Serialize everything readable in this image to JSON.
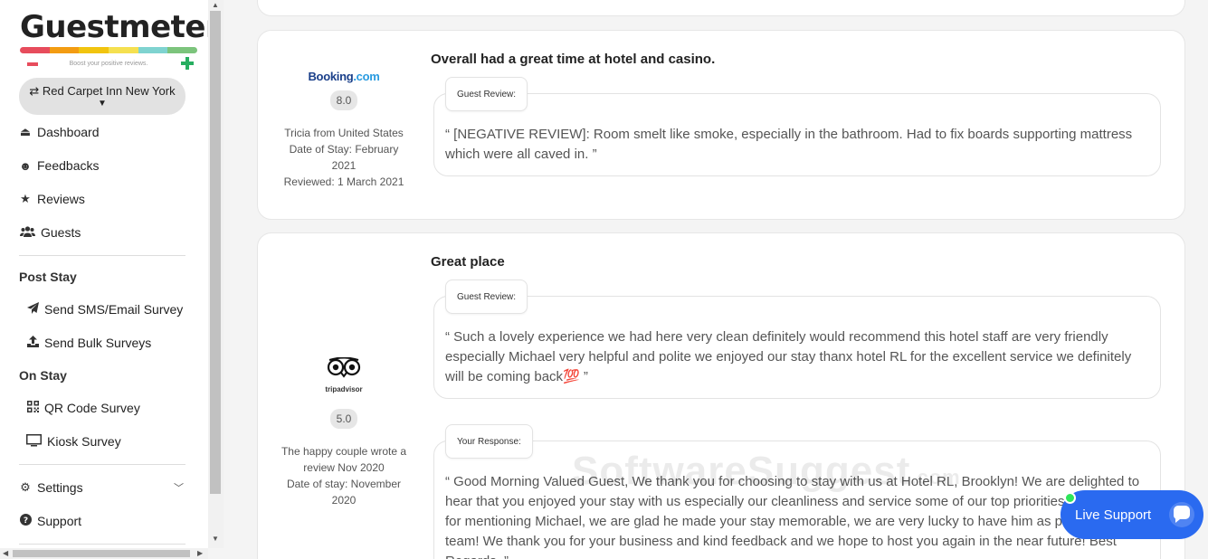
{
  "brand": {
    "name": "Guestmeter",
    "tagline": "Boost your positive reviews.",
    "bar_colors": [
      "#e74c5c",
      "#f39c12",
      "#f1c40f",
      "#f5e050",
      "#7fd3d0",
      "#7cc47c"
    ]
  },
  "hotel_selector": {
    "label": "⇄ Red Carpet Inn New York"
  },
  "sidebar": {
    "items": [
      {
        "label": "Dashboard",
        "icon": "eject-icon"
      },
      {
        "label": "Feedbacks",
        "icon": "smile-icon"
      },
      {
        "label": "Reviews",
        "icon": "star-icon"
      },
      {
        "label": "Guests",
        "icon": "users-icon"
      }
    ],
    "post_stay": {
      "title": "Post Stay",
      "items": [
        {
          "label": "Send SMS/Email Survey",
          "icon": "paper-plane-icon"
        },
        {
          "label": "Send Bulk Surveys",
          "icon": "upload-icon"
        }
      ]
    },
    "on_stay": {
      "title": "On Stay",
      "items": [
        {
          "label": "QR Code Survey",
          "icon": "qrcode-icon"
        },
        {
          "label": "Kiosk Survey",
          "icon": "monitor-icon"
        }
      ]
    },
    "settings": {
      "label": "Settings",
      "icon": "gear-icon"
    },
    "support": {
      "label": "Support",
      "icon": "question-icon"
    }
  },
  "reviews": [
    {
      "source": "Booking.com",
      "score": "8.0",
      "meta_lines": [
        "Tricia from United States",
        "Date of Stay: February 2021",
        "Reviewed: 1 March 2021"
      ],
      "title": "Overall had a great time at hotel and casino.",
      "guest_review_label": "Guest Review:",
      "text": "“ [NEGATIVE REVIEW]: Room smelt like smoke, especially in the bathroom. Had to fix boards supporting mattress which were all caved in. ”"
    },
    {
      "source": "tripadvisor",
      "score": "5.0",
      "meta_lines": [
        "The happy couple wrote a review Nov 2020",
        "Date of stay: November 2020"
      ],
      "title": "Great place",
      "guest_review_label": "Guest Review:",
      "text": "“ Such a lovely experience we had here very clean definitely would recommend this hotel staff are very friendly especially Michael very helpful and polite we enjoyed our stay thanx hotel RL for the excellent service we definitely will be coming back💯 ”",
      "response_label": "Your Response:",
      "response": "“ Good Morning Valued Guest, We thank you for choosing to stay with us at Hotel RL, Brooklyn! We are delighted to hear that you enjoyed your stay with us especially our cleanliness and service some of our top priorities. Thank you for mentioning Michael, we are glad he made your stay memorable, we are very lucky to have him as part of our team! We thank you for your business and kind feedback and we hope to host you again in the near future! Best Regards, ”"
    }
  ],
  "watermark": {
    "main": "SoftwareSuggest",
    "suffix": ".com"
  },
  "live_support": {
    "label": "Live Support"
  }
}
